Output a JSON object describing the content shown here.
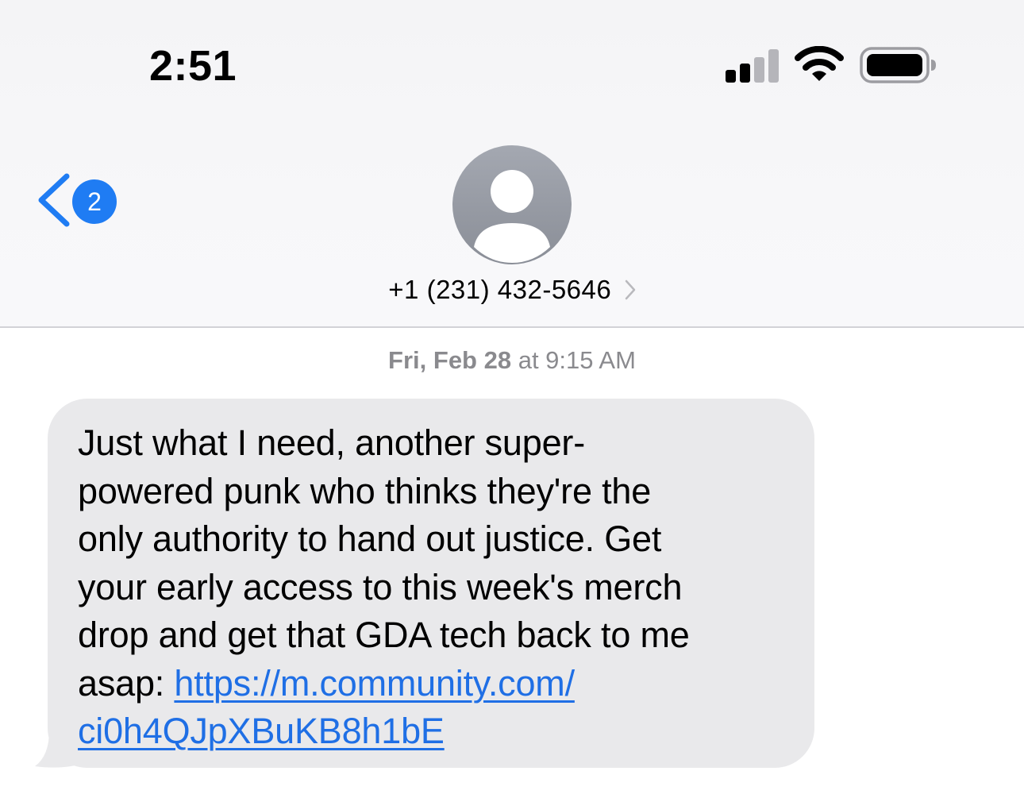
{
  "status_bar": {
    "time": "2:51",
    "signal_icon": "cellular-signal-icon",
    "wifi_icon": "wifi-icon",
    "battery_icon": "battery-icon",
    "signal_bars_active": 2,
    "signal_bars_total": 4
  },
  "header": {
    "back_badge_count": "2",
    "back_icon": "chevron-left-icon",
    "avatar_icon": "person-avatar-icon",
    "contact_name": "+1 (231) 432-5646",
    "contact_chevron_icon": "chevron-right-icon"
  },
  "conversation": {
    "timestamp_day": "Fri, Feb 28",
    "timestamp_time": "at 9:15 AM",
    "messages": [
      {
        "direction": "incoming",
        "text_lines": [
          "Just what I need, another super-",
          "powered punk who thinks they're the",
          "only authority to hand out justice. Get",
          "your early access to this week's merch",
          "drop and get that GDA tech back to me"
        ],
        "text_prefix": "asap: ",
        "link_line_1": "https://m.community.com/",
        "link_line_2": "ci0h4QJpXBuKB8h1bE"
      }
    ]
  },
  "colors": {
    "accent_blue": "#1f7cf3",
    "link_blue": "#1f6fe5",
    "bubble_gray": "#e9e9eb",
    "secondary_text": "#8a8a8e",
    "avatar_gray": "#9a9ea7"
  }
}
